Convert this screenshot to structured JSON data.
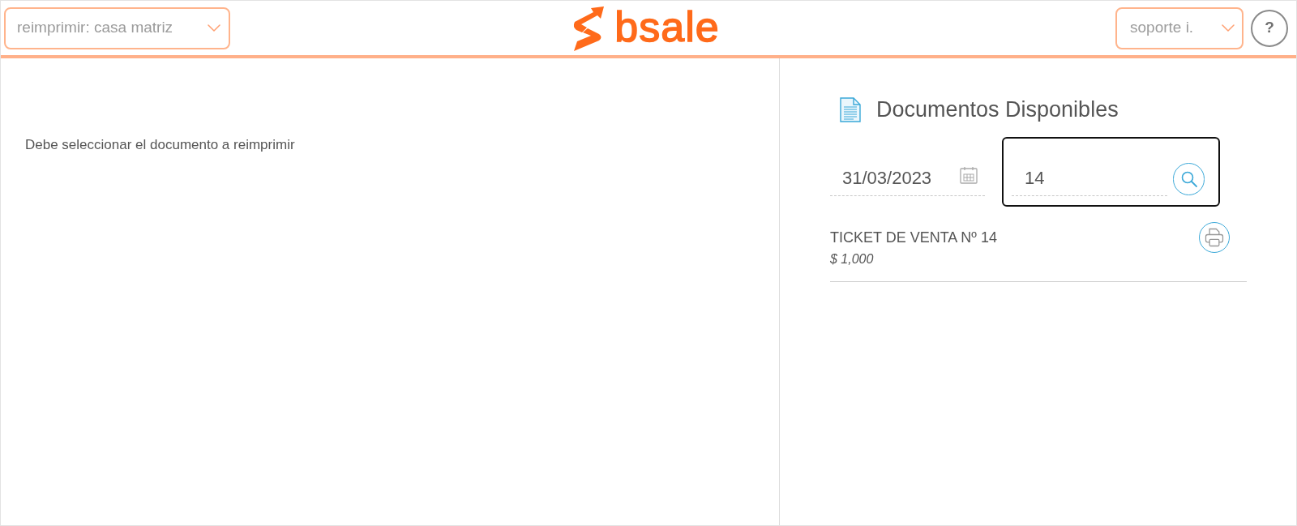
{
  "header": {
    "branch_select": {
      "value": "reimprimir: casa matriz"
    },
    "logo": {
      "text": "bsale"
    },
    "user_select": {
      "value": "soporte i."
    },
    "help_button": {
      "label": "?"
    }
  },
  "message": "Debe seleccionar el documento a reimprimir",
  "documents_panel": {
    "title": "Documentos Disponibles",
    "date_field": {
      "value": "31/03/2023"
    },
    "search_field": {
      "value": "14",
      "focused": true
    },
    "documents": [
      {
        "title": "TICKET DE VENTA Nº 14",
        "amount": "$ 1,000"
      }
    ]
  }
}
